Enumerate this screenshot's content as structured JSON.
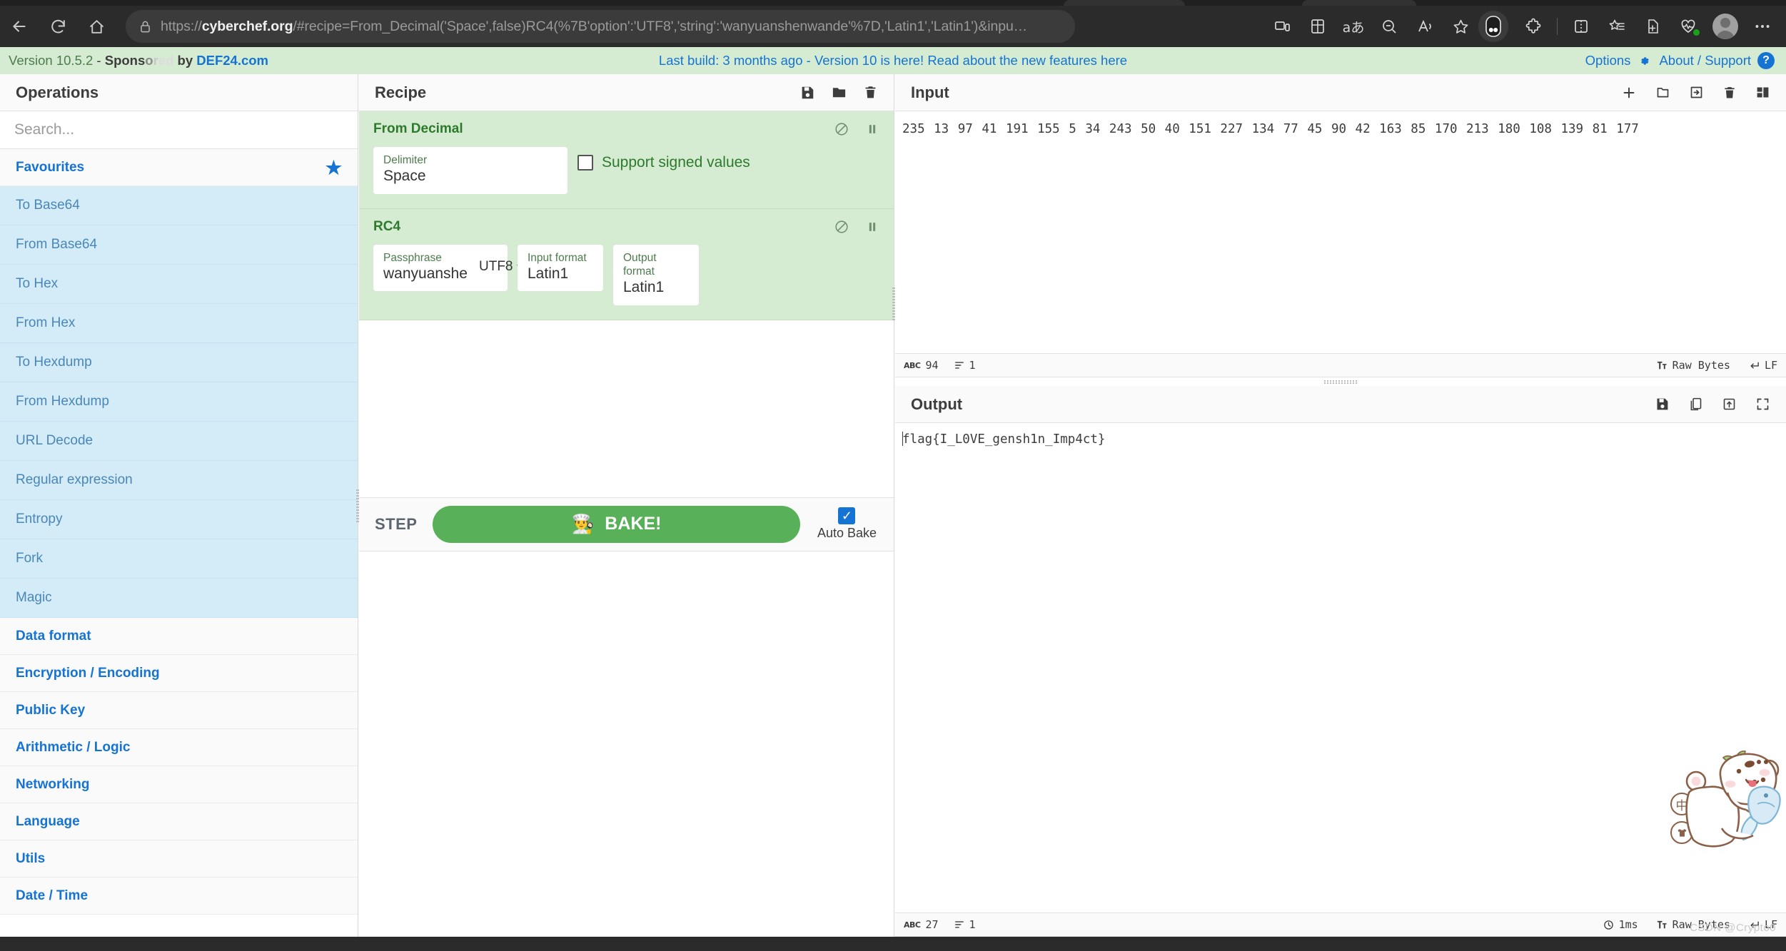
{
  "browser": {
    "url_scheme": "https://",
    "url_host": "cyberchef.org",
    "url_path": "/#recipe=From_Decimal('Space',false)RC4(%7B'option':'UTF8','string':'wanyuanshenwande'%7D,'Latin1','Latin1')&inpu…",
    "back_label": "Back",
    "refresh_label": "Refresh",
    "home_label": "Home",
    "lock_label": "Site information",
    "icons": [
      "split-screen-icon",
      "apps-grid-icon",
      "translate-icon",
      "zoom-out-icon",
      "read-aloud-icon",
      "favorites-star-icon",
      "copilot-icon",
      "extensions-puzzle-icon",
      "split-window-icon",
      "collections-icon",
      "add-favorite-icon",
      "browser-essentials-icon",
      "profile-avatar-icon",
      "settings-more-icon"
    ]
  },
  "banner": {
    "version": "Version 10.5.2",
    "dash": " - ",
    "sponsored": "Sponsored",
    "by": " by ",
    "sponsor_name": "DEF24.com",
    "center_text": "Last build: 3 months ago - Version 10 is here! Read about the new features ",
    "center_link": "here",
    "options_label": "Options",
    "about_label": "About / Support",
    "help_glyph": "?",
    "bg_color": "#d6ecd2",
    "link_color": "#1573d4"
  },
  "operations": {
    "title": "Operations",
    "search_placeholder": "Search...",
    "search_value": "",
    "favourites_label": "Favourites",
    "favourites": [
      "To Base64",
      "From Base64",
      "To Hex",
      "From Hex",
      "To Hexdump",
      "From Hexdump",
      "URL Decode",
      "Regular expression",
      "Entropy",
      "Fork",
      "Magic"
    ],
    "categories": [
      "Data format",
      "Encryption / Encoding",
      "Public Key",
      "Arithmetic / Logic",
      "Networking",
      "Language",
      "Utils",
      "Date / Time"
    ]
  },
  "recipe": {
    "title": "Recipe",
    "head_icons": [
      "save-recipe-icon",
      "load-recipe-icon",
      "clear-recipe-icon"
    ],
    "operations": [
      {
        "name": "From Decimal",
        "controls": [
          "disable-icon",
          "breakpoint-pause-icon"
        ],
        "args": [
          {
            "kind": "text",
            "label": "Delimiter",
            "value": "Space"
          },
          {
            "kind": "checkbox",
            "label": "Support signed values",
            "checked": false
          }
        ]
      },
      {
        "name": "RC4",
        "controls": [
          "disable-icon",
          "breakpoint-pause-icon"
        ],
        "args": [
          {
            "kind": "text-with-option",
            "label": "Passphrase",
            "value": "wanyuanshenwa…",
            "option": "UTF8"
          },
          {
            "kind": "text",
            "label": "Input format",
            "value": "Latin1"
          },
          {
            "kind": "text",
            "label": "Output format",
            "value": "Latin1"
          }
        ]
      }
    ],
    "step_label": "STEP",
    "bake_label": "BAKE!",
    "bake_emoji": "👨‍🍳",
    "bake_color": "#58b058",
    "autobake_label": "Auto Bake",
    "autobake_checked": true,
    "autobake_color": "#1573d4"
  },
  "input": {
    "title": "Input",
    "head_icons": [
      "add-tab-icon",
      "open-folder-icon",
      "open-file-icon",
      "clear-input-icon",
      "reset-layout-icon"
    ],
    "value": "235 13 97 41 191 155 5 34 243 50 40 151 227 134 77 45 90 42 163 85 170 213 180 108 139 81 177",
    "status": {
      "chars_icon": "abc-icon",
      "chars": "94",
      "lines_icon": "lines-icon",
      "lines": "1",
      "encoding_icon": "font-icon",
      "encoding": "Raw Bytes",
      "eol_icon": "return-icon",
      "eol": "LF"
    }
  },
  "output": {
    "title": "Output",
    "head_icons": [
      "save-output-icon",
      "copy-output-icon",
      "replace-input-icon",
      "maximise-icon"
    ],
    "value": "flag{I_L0VE_gensh1n_Imp4ct}",
    "status": {
      "chars_icon": "abc-icon",
      "chars": "27",
      "lines_icon": "lines-icon",
      "lines": "1",
      "time_icon": "clock-icon",
      "time": "1ms",
      "encoding_icon": "font-icon",
      "encoding": "Raw Bytes",
      "eol_icon": "return-icon",
      "eol": "LF"
    }
  },
  "ime_widget": {
    "mode_button": "中",
    "skin_button": "shirt-glyph",
    "mascot": "bear-holding-fish"
  },
  "watermark": "CSDN @Crypto0"
}
